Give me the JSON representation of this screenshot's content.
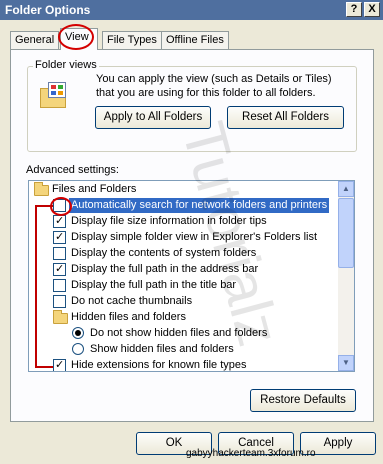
{
  "window": {
    "title": "Folder Options",
    "help_btn": "?",
    "close_btn": "X"
  },
  "tabs": [
    {
      "label": "General",
      "active": false
    },
    {
      "label": "View",
      "active": true
    },
    {
      "label": "File Types",
      "active": false
    },
    {
      "label": "Offline Files",
      "active": false
    }
  ],
  "folder_views": {
    "legend": "Folder views",
    "description": "You can apply the view (such as Details or Tiles) that you are using for this folder to all folders.",
    "apply_btn": "Apply to All Folders",
    "reset_btn": "Reset All Folders"
  },
  "advanced": {
    "label": "Advanced settings:",
    "items": [
      {
        "kind": "folder",
        "label": "Files and Folders"
      },
      {
        "kind": "checkbox",
        "label": "Automatically search for network folders and printers",
        "checked": false,
        "selected": true
      },
      {
        "kind": "checkbox",
        "label": "Display file size information in folder tips",
        "checked": true
      },
      {
        "kind": "checkbox",
        "label": "Display simple folder view in Explorer's Folders list",
        "checked": true
      },
      {
        "kind": "checkbox",
        "label": "Display the contents of system folders",
        "checked": false
      },
      {
        "kind": "checkbox",
        "label": "Display the full path in the address bar",
        "checked": true
      },
      {
        "kind": "checkbox",
        "label": "Display the full path in the title bar",
        "checked": false
      },
      {
        "kind": "checkbox",
        "label": "Do not cache thumbnails",
        "checked": false
      },
      {
        "kind": "folder",
        "label": "Hidden files and folders"
      },
      {
        "kind": "radio",
        "label": "Do not show hidden files and folders",
        "checked": true
      },
      {
        "kind": "radio",
        "label": "Show hidden files and folders",
        "checked": false
      },
      {
        "kind": "checkbox",
        "label": "Hide extensions for known file types",
        "checked": true
      }
    ],
    "restore_btn": "Restore Defaults"
  },
  "buttons": {
    "ok": "OK",
    "cancel": "Cancel",
    "apply": "Apply"
  },
  "watermark": "Tutorialz",
  "footer": "gabyyhackerteam.3xforum.ro",
  "colors": {
    "selection": "#316ac5",
    "annotation": "#d40000"
  }
}
